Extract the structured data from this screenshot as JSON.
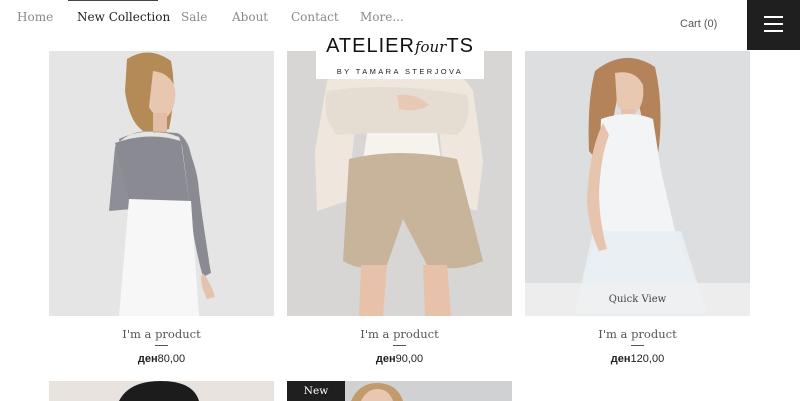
{
  "nav": {
    "items": [
      {
        "label": "Home"
      },
      {
        "label": "New Collection"
      },
      {
        "label": "Sale"
      },
      {
        "label": "About"
      },
      {
        "label": "Contact"
      },
      {
        "label": "More..."
      }
    ],
    "active_index": 1,
    "cart_label": "Cart (0)",
    "menu_icon": "hamburger-icon"
  },
  "logo": {
    "main_left": "ATELIER",
    "main_script": "four",
    "main_right": "TS",
    "sub": "BY TAMARA STERJOVA"
  },
  "products": [
    {
      "name": "I'm a product",
      "currency": "ден",
      "amount": "80,00"
    },
    {
      "name": "I'm a product",
      "currency": "ден",
      "amount": "90,00"
    },
    {
      "name": "I'm a product",
      "currency": "ден",
      "amount": "120,00"
    }
  ],
  "quick_view_label": "Quick View",
  "new_badge": "New"
}
